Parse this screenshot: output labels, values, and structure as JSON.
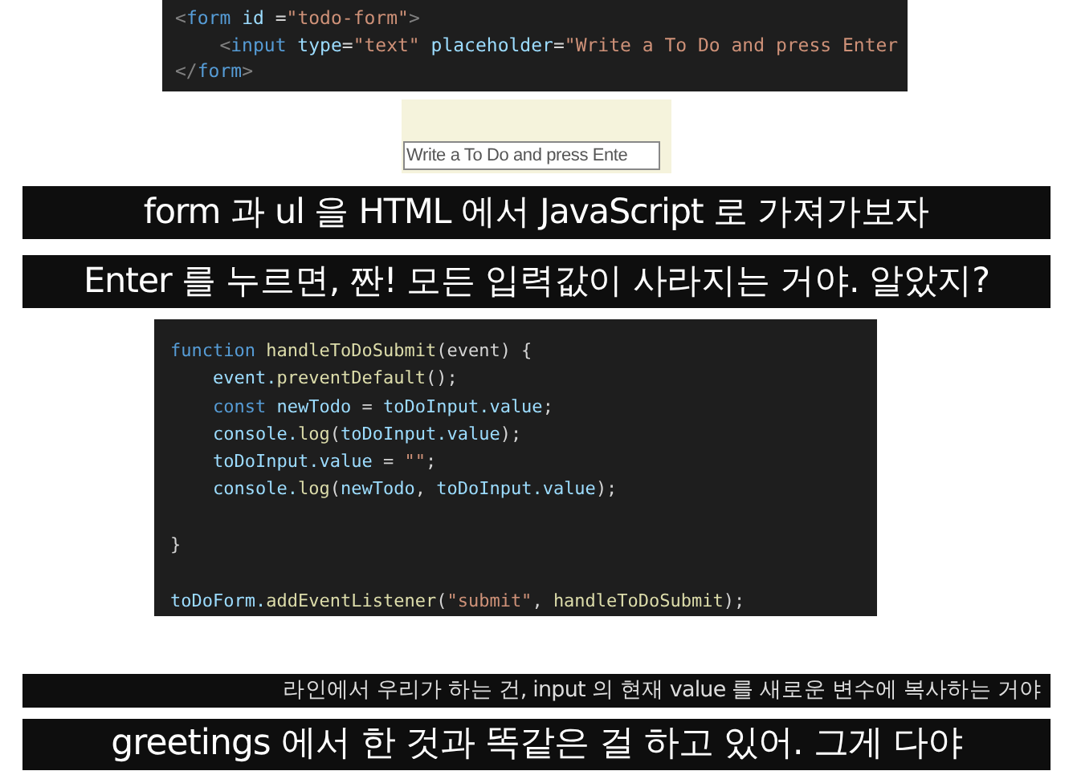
{
  "html_snippet": {
    "lines": [
      [
        {
          "text": "<",
          "kind": "punct"
        },
        {
          "text": "form",
          "kind": "tag"
        },
        {
          "text": " id",
          "kind": "attr"
        },
        {
          "text": " =",
          "kind": "plain"
        },
        {
          "text": "\"todo-form\"",
          "kind": "string"
        },
        {
          "text": ">",
          "kind": "punct"
        }
      ],
      [
        {
          "text": "    <",
          "kind": "punct"
        },
        {
          "text": "input",
          "kind": "tag"
        },
        {
          "text": " type",
          "kind": "attr"
        },
        {
          "text": "=",
          "kind": "plain"
        },
        {
          "text": "\"text\"",
          "kind": "string"
        },
        {
          "text": " placeholder",
          "kind": "attr"
        },
        {
          "text": "=",
          "kind": "plain"
        },
        {
          "text": "\"Write a To Do and press Enter",
          "kind": "string"
        }
      ],
      [
        {
          "text": "</",
          "kind": "punct"
        },
        {
          "text": "form",
          "kind": "tag"
        },
        {
          "text": ">",
          "kind": "punct"
        }
      ]
    ]
  },
  "browser_preview": {
    "placeholder": "Write a To Do and press Ente"
  },
  "captions_top": [
    "form 과 ul 을 HTML 에서 JavaScript 로 가져가보자",
    "Enter 를 누르면, 짠! 모든 입력값이 사라지는 거야. 알았지?"
  ],
  "js_snippet": {
    "lines": [
      [
        {
          "text": "function",
          "kind": "keyword"
        },
        {
          "text": " handleToDoSubmit",
          "kind": "func"
        },
        {
          "text": "(event) {",
          "kind": "plain"
        }
      ],
      [
        {
          "text": "    event.",
          "kind": "var"
        },
        {
          "text": "preventDefault",
          "kind": "func"
        },
        {
          "text": "();",
          "kind": "plain"
        }
      ],
      [
        {
          "text": "    const",
          "kind": "keyword"
        },
        {
          "text": " newTodo",
          "kind": "var"
        },
        {
          "text": " = ",
          "kind": "plain"
        },
        {
          "text": "toDoInput.value",
          "kind": "var"
        },
        {
          "text": ";",
          "kind": "plain"
        }
      ],
      [
        {
          "text": "    console.",
          "kind": "var"
        },
        {
          "text": "log",
          "kind": "func"
        },
        {
          "text": "(",
          "kind": "plain"
        },
        {
          "text": "toDoInput.value",
          "kind": "var"
        },
        {
          "text": ");",
          "kind": "plain"
        }
      ],
      [
        {
          "text": "    toDoInput.value",
          "kind": "var"
        },
        {
          "text": " = ",
          "kind": "plain"
        },
        {
          "text": "\"\"",
          "kind": "string"
        },
        {
          "text": ";",
          "kind": "plain"
        }
      ],
      [
        {
          "text": "    console.",
          "kind": "var"
        },
        {
          "text": "log",
          "kind": "func"
        },
        {
          "text": "(",
          "kind": "plain"
        },
        {
          "text": "newTodo",
          "kind": "var"
        },
        {
          "text": ", ",
          "kind": "plain"
        },
        {
          "text": "toDoInput.value",
          "kind": "var"
        },
        {
          "text": ");",
          "kind": "plain"
        }
      ],
      [
        {
          "text": "}",
          "kind": "plain"
        }
      ],
      [
        {
          "text": "toDoForm.",
          "kind": "var"
        },
        {
          "text": "addEventListener",
          "kind": "func"
        },
        {
          "text": "(",
          "kind": "plain"
        },
        {
          "text": "\"submit\"",
          "kind": "string"
        },
        {
          "text": ", ",
          "kind": "plain"
        },
        {
          "text": "handleToDoSubmit",
          "kind": "func"
        },
        {
          "text": ");",
          "kind": "plain"
        }
      ]
    ]
  },
  "caption_small": "라인에서 우리가 하는 건, input 의 현재 value 를 새로운 변수에 복사하는 거야",
  "caption_large": "greetings 에서 한 것과 똑같은 걸 하고 있어. 그게 다야"
}
